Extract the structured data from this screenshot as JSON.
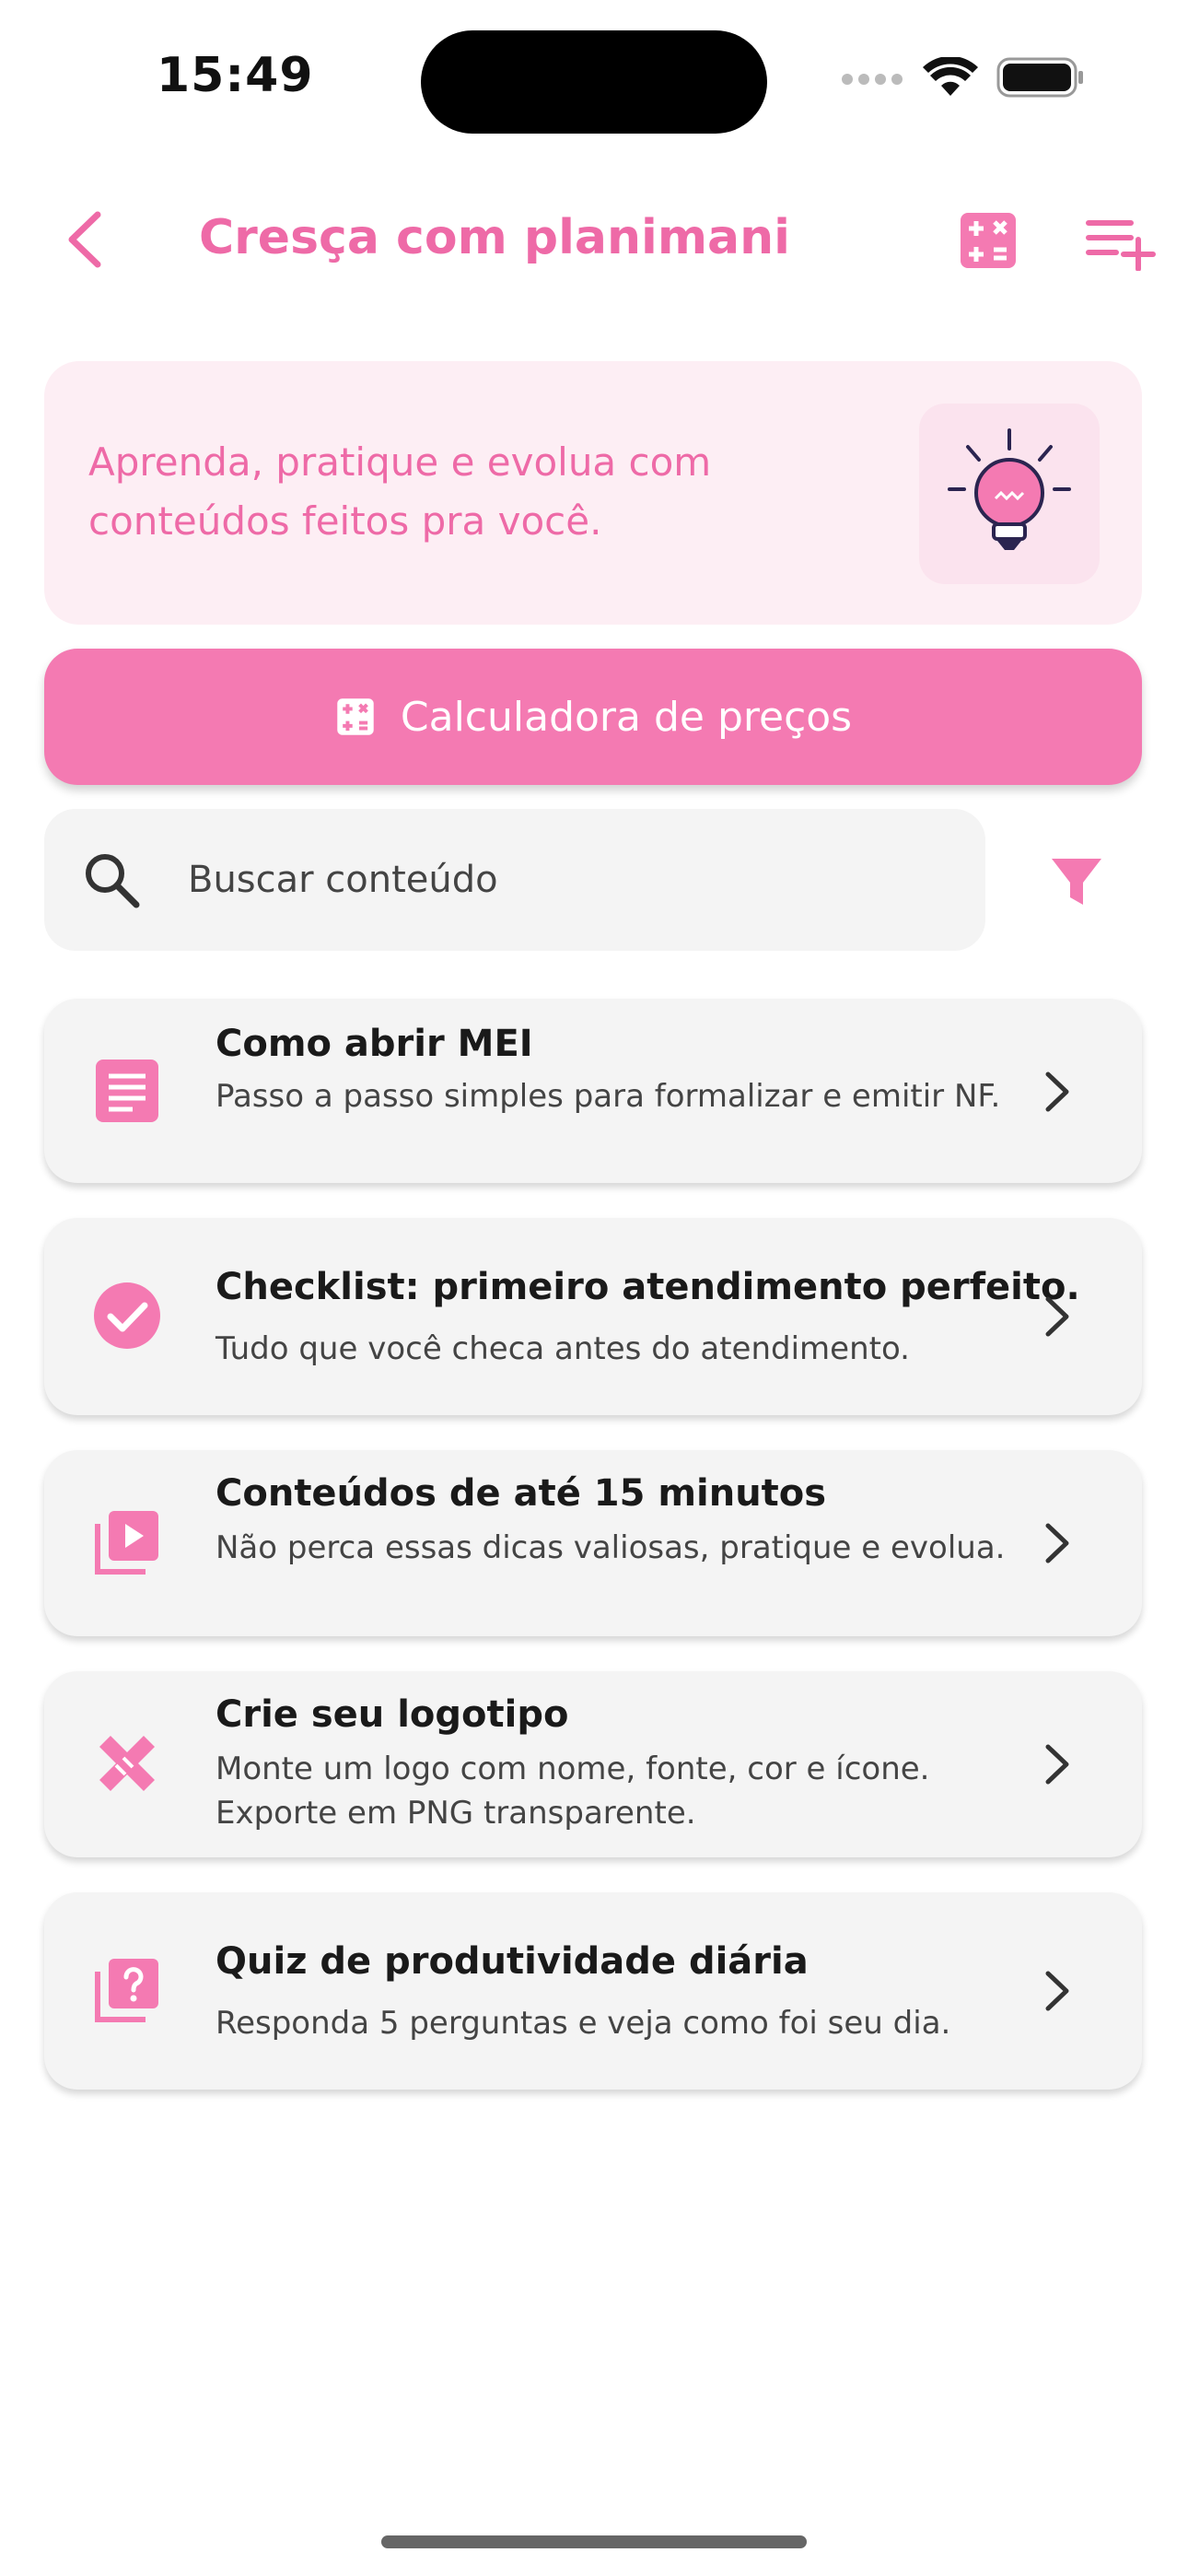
{
  "status_bar": {
    "time": "15:49"
  },
  "header": {
    "title": "Cresça com planimani",
    "back_icon": "chevron-left-icon",
    "calculator_icon": "calculator-icon",
    "list_add_icon": "playlist-add-icon"
  },
  "banner": {
    "text": "Aprenda, pratique e evolua com conteúdos feitos pra você.",
    "icon": "lightbulb-icon"
  },
  "primary_button": {
    "label": "Calculadora de preços",
    "icon": "calculator-icon"
  },
  "search": {
    "placeholder": "Buscar conteúdo",
    "value": ""
  },
  "colors": {
    "accent": "#f47ab2",
    "accent_text": "#ee6aa7",
    "banner_bg": "#fdeef4",
    "card_bg": "#f4f4f4"
  },
  "items": [
    {
      "title": "Como abrir MEI",
      "subtitle": "Passo a passo simples para formalizar e emitir NF.",
      "icon": "document-icon"
    },
    {
      "title": "Checklist: primeiro atendimento perfeito.",
      "subtitle": "Tudo que você checa antes do atendimento.",
      "icon": "check-circle-icon"
    },
    {
      "title": "Conteúdos de até 15 minutos",
      "subtitle": "Não perca essas dicas valiosas, pratique e evolua.",
      "icon": "video-library-icon"
    },
    {
      "title": "Crie seu logotipo",
      "subtitle": "Monte um logo com nome, fonte, cor e ícone. Exporte em PNG transparente.",
      "icon": "design-tools-icon"
    },
    {
      "title": "Quiz de produtividade diária",
      "subtitle": "Responda 5 perguntas e veja como foi seu dia.",
      "icon": "quiz-icon"
    }
  ]
}
